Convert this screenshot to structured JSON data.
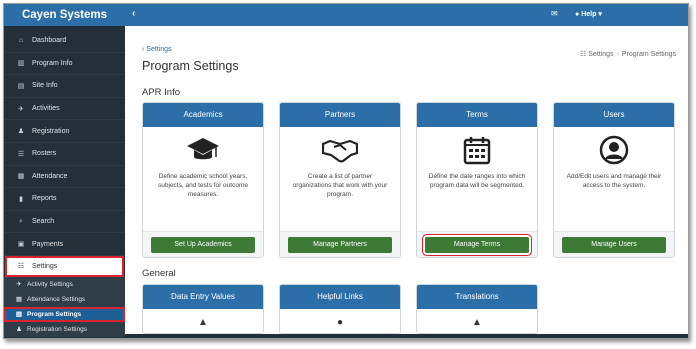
{
  "brand": "Cayen Systems",
  "sidebar": {
    "items": [
      {
        "icon": "⌂",
        "label": "Dashboard"
      },
      {
        "icon": "▥",
        "label": "Program Info"
      },
      {
        "icon": "▤",
        "label": "Site Info"
      },
      {
        "icon": "✈",
        "label": "Activities"
      },
      {
        "icon": "♟",
        "label": "Registration"
      },
      {
        "icon": "☰",
        "label": "Rosters"
      },
      {
        "icon": "▦",
        "label": "Attendance"
      },
      {
        "icon": "▮",
        "label": "Reports"
      },
      {
        "icon": "⌕",
        "label": "Search"
      },
      {
        "icon": "▣",
        "label": "Payments"
      },
      {
        "icon": "☷",
        "label": "Settings"
      }
    ],
    "sub_items": [
      {
        "icon": "✈",
        "label": "Activity Settings"
      },
      {
        "icon": "▦",
        "label": "Attendance Settings"
      },
      {
        "icon": "▥",
        "label": "Program Settings"
      },
      {
        "icon": "♟",
        "label": "Registration Settings"
      }
    ]
  },
  "topbar": {
    "back_icon": "‹",
    "mail_icon": "✉",
    "help_label": "Help"
  },
  "main": {
    "back_link": "Settings",
    "page_title": "Program Settings",
    "breadcrumb": {
      "parent": "Settings",
      "current": "Program Settings"
    },
    "section_apr": "APR Info",
    "section_general": "General",
    "apr_cards": [
      {
        "title": "Academics",
        "icon": "graduation-cap-icon",
        "desc": "Define academic school years, subjects, and tests for outcome measures.",
        "button": "Set Up Academics"
      },
      {
        "title": "Partners",
        "icon": "handshake-icon",
        "desc": "Create a list of partner organizations that work with your program.",
        "button": "Manage Partners"
      },
      {
        "title": "Terms",
        "icon": "calendar-icon",
        "desc": "Define the date ranges into which program data will be segmented.",
        "button": "Manage Terms"
      },
      {
        "title": "Users",
        "icon": "user-icon",
        "desc": "Add/Edit users and manage their access to the system.",
        "button": "Manage Users"
      }
    ],
    "general_cards": [
      {
        "title": "Data Entry Values"
      },
      {
        "title": "Helpful Links"
      },
      {
        "title": "Translations"
      }
    ]
  },
  "colors": {
    "brand_blue": "#2c6fa8",
    "sidebar_dark": "#243039",
    "button_green": "#3c7a36",
    "highlight_red": "#d9232d"
  }
}
